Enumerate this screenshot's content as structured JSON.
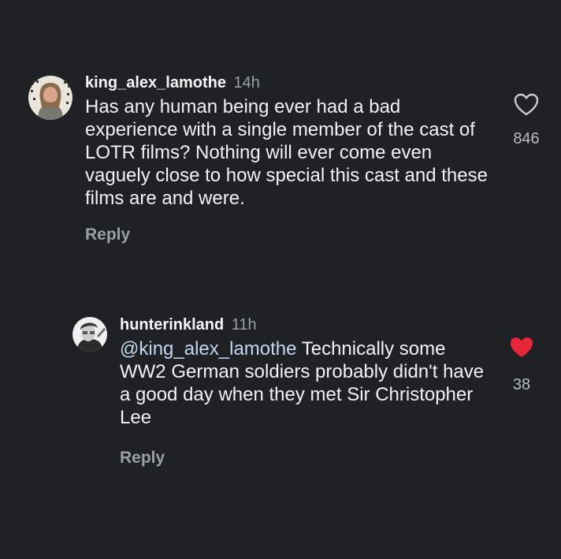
{
  "comments": [
    {
      "username": "king_alex_lamothe",
      "time": "14h",
      "text": "Has any human being ever had a bad experience with a single member of the cast of LOTR films? Nothing will ever come even vaguely close to how special this cast and these films are and were.",
      "reply_label": "Reply",
      "like_count": "846",
      "liked": false
    },
    {
      "username": "hunterinkland",
      "time": "11h",
      "mention": "@king_alex_lamothe",
      "text": " Technically some WW2 German soldiers probably didn't have a good day when they met Sir Christopher Lee",
      "reply_label": "Reply",
      "like_count": "38",
      "liked": true
    }
  ],
  "colors": {
    "background": "#1f2125",
    "liked_heart": "#e8263a",
    "mention": "#c3d7ee"
  }
}
